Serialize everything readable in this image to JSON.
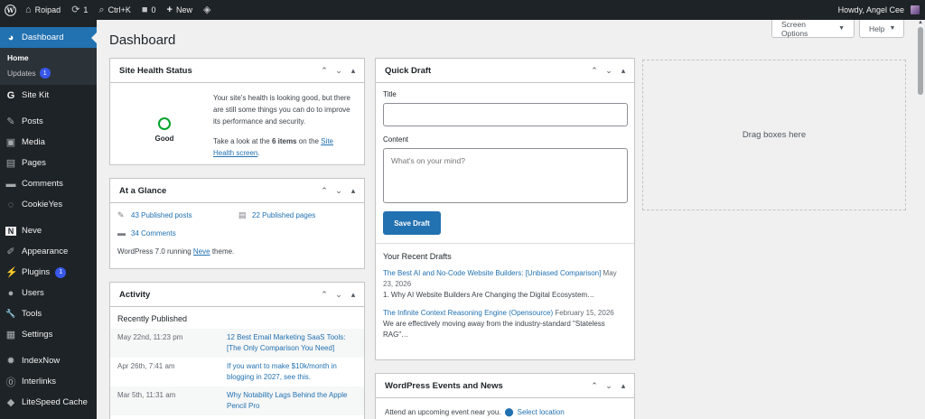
{
  "adminbar": {
    "site_name": "Roipad",
    "updates_count": "1",
    "search_shortcut": "Ctrl+K",
    "comments_count": "0",
    "new_label": "New",
    "howdy": "Howdy, Angel Cee"
  },
  "sidebar": {
    "dashboard": "Dashboard",
    "home": "Home",
    "updates": "Updates",
    "updates_badge": "1",
    "items": [
      {
        "label": "Site Kit",
        "icon": "G"
      },
      {
        "label": "Posts",
        "icon": "✎"
      },
      {
        "label": "Media",
        "icon": "▣"
      },
      {
        "label": "Pages",
        "icon": "▤"
      },
      {
        "label": "Comments",
        "icon": "▬"
      },
      {
        "label": "CookieYes",
        "icon": "◌"
      },
      {
        "label": "Neve",
        "icon": "N"
      },
      {
        "label": "Appearance",
        "icon": "✐"
      },
      {
        "label": "Plugins",
        "icon": "⚡",
        "badge": "1"
      },
      {
        "label": "Users",
        "icon": "●"
      },
      {
        "label": "Tools",
        "icon": "🔧"
      },
      {
        "label": "Settings",
        "icon": "▦"
      },
      {
        "label": "IndexNow",
        "icon": "✹"
      },
      {
        "label": "Interlinks",
        "icon": "⓪"
      },
      {
        "label": "LiteSpeed Cache",
        "icon": "◆"
      }
    ]
  },
  "page": {
    "title": "Dashboard",
    "screen_options": "Screen Options",
    "help": "Help"
  },
  "site_health": {
    "title": "Site Health Status",
    "status": "Good",
    "text1": "Your site's health is looking good, but there are still some things you can do to improve its performance and security.",
    "text2_prefix": "Take a look at the ",
    "text2_bold": "6 items",
    "text2_mid": " on the ",
    "text2_link": "Site Health screen",
    "text2_suffix": "."
  },
  "glance": {
    "title": "At a Glance",
    "posts": "43 Published posts",
    "pages": "22 Published pages",
    "comments": "34 Comments",
    "footer_prefix": "WordPress 7.0 running ",
    "footer_theme": "Neve",
    "footer_suffix": " theme."
  },
  "activity": {
    "title": "Activity",
    "subtitle": "Recently Published",
    "rows": [
      {
        "date": "May 22nd, 11:23 pm",
        "title": "12 Best Email Marketing SaaS Tools: [The Only Comparison You Need]"
      },
      {
        "date": "Apr 26th, 7:41 am",
        "title": "If you want to make $10k/month in blogging in 2027, see this."
      },
      {
        "date": "Mar 5th, 11:31 am",
        "title": "Why Notability Lags Behind the Apple Pencil Pro"
      }
    ]
  },
  "quick_draft": {
    "title": "Quick Draft",
    "title_label": "Title",
    "content_label": "Content",
    "content_placeholder": "What's on your mind?",
    "save_label": "Save Draft",
    "recent_label": "Your Recent Drafts",
    "drafts": [
      {
        "title": "The Best AI and No-Code Website Builders: [Unbiased Comparison]",
        "date": "May 23, 2026",
        "excerpt": "1. Why AI Website Builders Are Changing the Digital Ecosystem…"
      },
      {
        "title": "The Infinite Context Reasoning Engine (Opensource)",
        "date": "February 15, 2026",
        "excerpt": "We are effectively moving away from the industry-standard \"Stateless RAG\"…"
      }
    ]
  },
  "events": {
    "title": "WordPress Events and News",
    "text": "Attend an upcoming event near you.",
    "link": "Select location"
  },
  "drag": {
    "label": "Drag boxes here"
  }
}
